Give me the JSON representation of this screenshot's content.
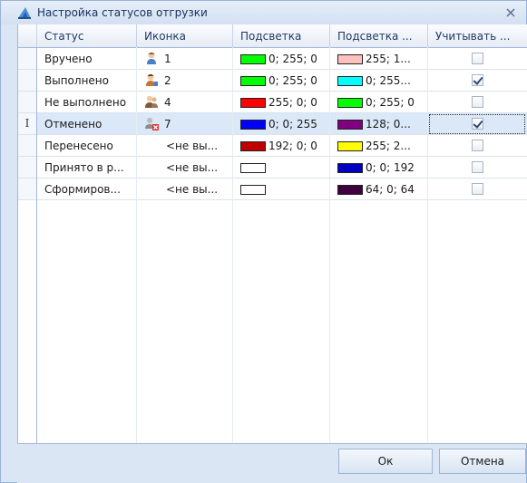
{
  "window": {
    "title": "Настройка статусов отгрузки"
  },
  "columns": [
    "Статус",
    "Иконка",
    "Подсветка",
    "Подсветка ...",
    "Учитывать ..."
  ],
  "rows": [
    {
      "status": "Вручено",
      "icon": "person-blue-icon",
      "icon_num": "1",
      "c1": "#00ff00",
      "c1_text": "0; 255; 0",
      "c2": "#ffc0c0",
      "c2_text": "255; 1...",
      "checked": false,
      "indicator": ""
    },
    {
      "status": "Выполнено",
      "icon": "person-orange-icon",
      "icon_num": "2",
      "c1": "#00ff00",
      "c1_text": "0; 255; 0",
      "c2": "#00ffff",
      "c2_text": "0; 255...",
      "checked": true,
      "indicator": ""
    },
    {
      "status": "Не выполнено",
      "icon": "person-pair-icon",
      "icon_num": "4",
      "c1": "#ff0000",
      "c1_text": "255; 0; 0",
      "c2": "#00ff00",
      "c2_text": "0; 255; 0",
      "checked": false,
      "indicator": ""
    },
    {
      "status": "Отменено",
      "icon": "cancel-person-icon",
      "icon_num": "7",
      "c1": "#0000ff",
      "c1_text": "0; 0; 255",
      "c2": "#800080",
      "c2_text": "128; 0...",
      "checked": true,
      "indicator": "I"
    },
    {
      "status": "Перенесено",
      "icon": "",
      "icon_num": "<не вы...",
      "c1": "#c00000",
      "c1_text": "192; 0; 0",
      "c2": "#ffff00",
      "c2_text": "255; 2...",
      "checked": false,
      "indicator": ""
    },
    {
      "status": "Принято в р...",
      "icon": "",
      "icon_num": "<не вы...",
      "c1": "#ffffff",
      "c1_text": "",
      "c2": "#0000c0",
      "c2_text": "0; 0; 192",
      "checked": false,
      "indicator": ""
    },
    {
      "status": "Сформиров...",
      "icon": "",
      "icon_num": "<не вы...",
      "c1": "#ffffff",
      "c1_text": "",
      "c2": "#400040",
      "c2_text": "64; 0; 64",
      "checked": false,
      "indicator": ""
    }
  ],
  "buttons": {
    "ok": "Ок",
    "cancel": "Отмена"
  },
  "colors": {
    "accent": "#15325c",
    "selection": "#dbe8f8",
    "border": "#a3b8d6"
  }
}
